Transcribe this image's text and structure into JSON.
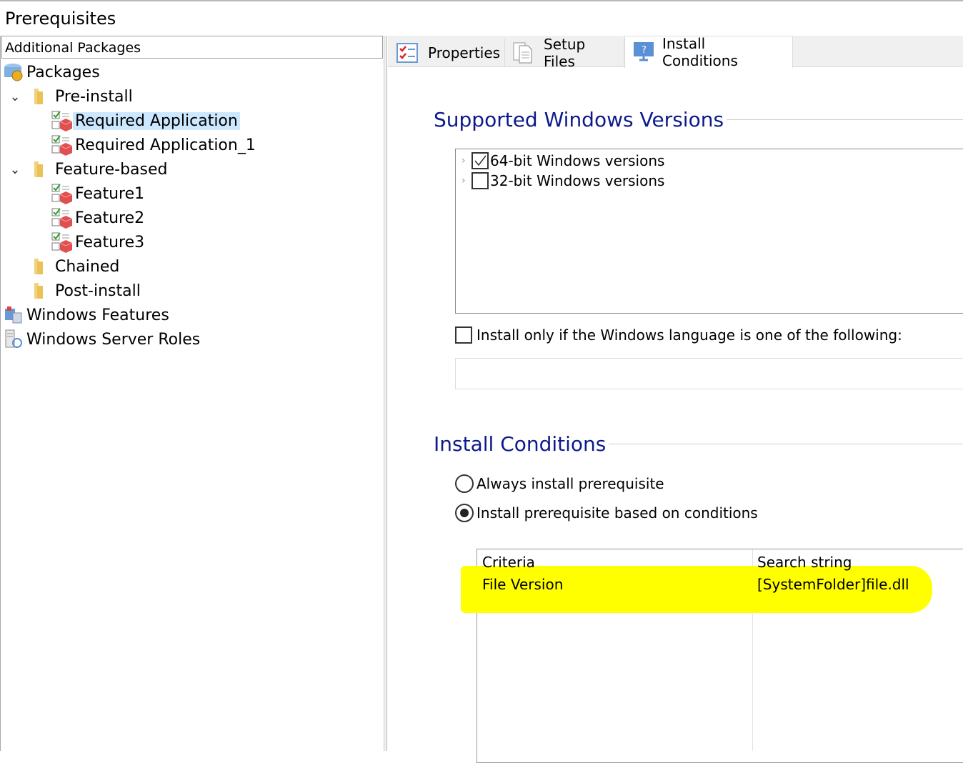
{
  "title": "Prerequisites",
  "left_panel": {
    "header": "Additional Packages",
    "tree": [
      {
        "label": "Packages",
        "icon": "packages-icon"
      },
      {
        "label": "Pre-install",
        "icon": "folder-icon",
        "expanded": true
      },
      {
        "label": "Required Application",
        "icon": "package-icon",
        "selected": true
      },
      {
        "label": "Required Application_1",
        "icon": "package-icon"
      },
      {
        "label": "Feature-based",
        "icon": "folder-icon",
        "expanded": true
      },
      {
        "label": "Feature1",
        "icon": "package-icon"
      },
      {
        "label": "Feature2",
        "icon": "package-icon"
      },
      {
        "label": "Feature3",
        "icon": "package-icon"
      },
      {
        "label": "Chained",
        "icon": "folder-icon"
      },
      {
        "label": "Post-install",
        "icon": "folder-icon"
      },
      {
        "label": "Windows Features",
        "icon": "windows-features-icon"
      },
      {
        "label": "Windows Server Roles",
        "icon": "server-roles-icon"
      }
    ]
  },
  "tabs": [
    {
      "label": "Properties",
      "icon": "checklist-icon"
    },
    {
      "label": "Setup Files",
      "icon": "document-icon"
    },
    {
      "label": "Install Conditions",
      "icon": "monitor-question-icon",
      "active": true
    }
  ],
  "supported": {
    "heading": "Supported Windows Versions",
    "items": [
      {
        "label": "64-bit Windows versions",
        "checked": true
      },
      {
        "label": "32-bit Windows versions",
        "checked": false
      }
    ],
    "language_checkbox": {
      "label": "Install only if the Windows language is one of the following:",
      "checked": false
    },
    "language_value": ""
  },
  "conditions": {
    "heading": "Install Conditions",
    "options": [
      {
        "label": "Always install prerequisite",
        "selected": false
      },
      {
        "label": "Install prerequisite based on conditions",
        "selected": true
      }
    ],
    "table": {
      "columns": [
        "Criteria",
        "Search string"
      ],
      "rows": [
        [
          "File Version",
          "[SystemFolder]file.dll"
        ]
      ]
    }
  },
  "colors": {
    "heading": "#0d1a8c",
    "selection": "#cce8ff",
    "highlight": "#ffff00"
  }
}
